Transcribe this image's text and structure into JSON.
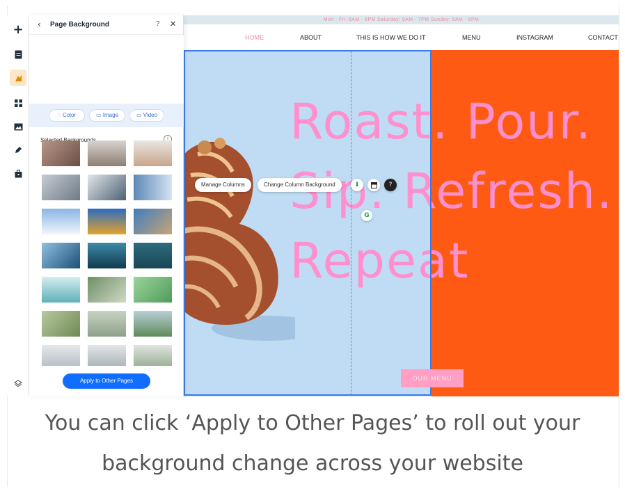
{
  "site": {
    "topbar_text": "Mon - Fri: 8AM - 8PM    Saturday: 9AM - 7PM    Sunday: 9AM - 8PM",
    "nav": [
      {
        "label": "HOME",
        "active": true
      },
      {
        "label": "ABOUT",
        "active": false
      },
      {
        "label": "THIS IS HOW WE DO IT",
        "active": false
      },
      {
        "label": "MENU",
        "active": false
      },
      {
        "label": "INSTAGRAM",
        "active": false
      },
      {
        "label": "CONTACT",
        "active": false
      }
    ],
    "headline": [
      "Roast. Pour.",
      "Sip. Refresh.",
      "Repeat"
    ],
    "cta": "OUR MENU",
    "colors": {
      "left_bg": "#bfdcf4",
      "right_bg": "#ff5a14",
      "headline": "#ff8fce",
      "selection": "#3b7be8"
    }
  },
  "column_toolbar": {
    "manage_columns": "Manage Columns",
    "change_background": "Change Column Background",
    "icons": [
      "move-down-icon",
      "layout-icon",
      "help-icon"
    ]
  },
  "toolbar": {
    "icons": [
      "add-icon",
      "pages-icon",
      "design-icon",
      "apps-icon",
      "media-icon",
      "blog-icon",
      "business-icon",
      "layers-icon"
    ]
  },
  "panel": {
    "title": "Page Background",
    "help": "?",
    "tabs": [
      {
        "label": "Color",
        "icon": "color-icon"
      },
      {
        "label": "Image",
        "icon": "image-icon"
      },
      {
        "label": "Video",
        "icon": "video-icon"
      }
    ],
    "selected_label": "Selected Backgrounds",
    "apply_label": "Apply to Other Pages",
    "accent": "#116dff"
  },
  "caption": {
    "line1": "You can click ‘Apply to Other Pages’ to roll out your",
    "line2": "background change across your website"
  }
}
